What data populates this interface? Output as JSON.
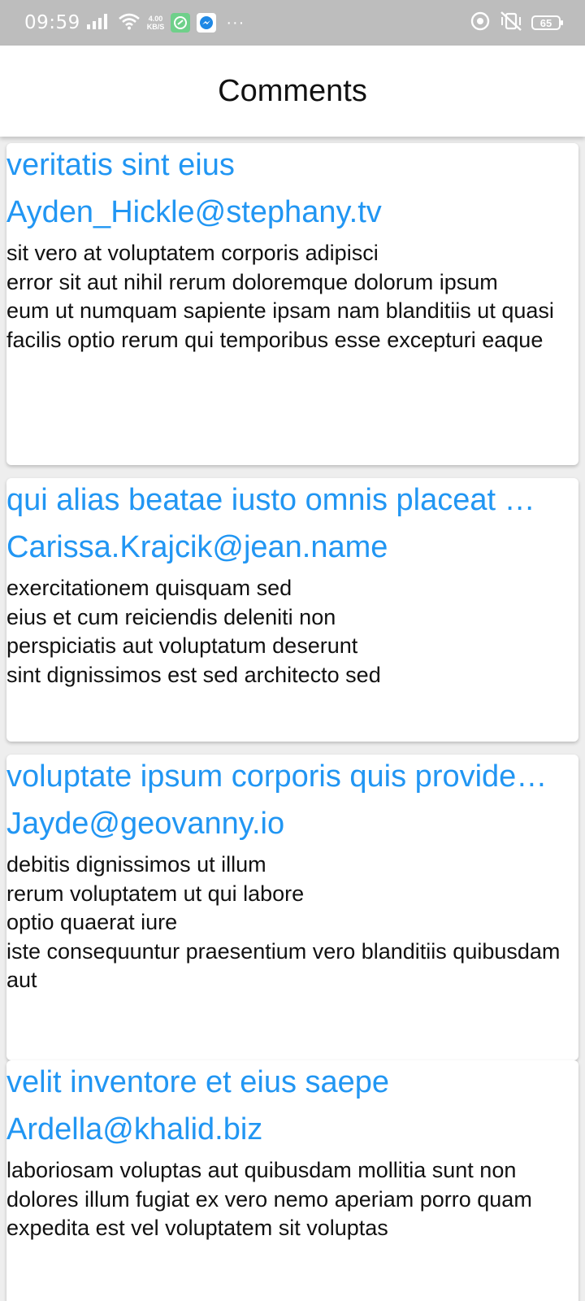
{
  "status_bar": {
    "time": "09:59",
    "speed_value": "4.00",
    "speed_unit": "KB/S",
    "more": "···",
    "battery": "65",
    "icons": [
      "signal-icon",
      "wifi-icon",
      "chat-app-icon",
      "messenger-icon",
      "sync-icon",
      "vibrate-off-icon",
      "battery-icon"
    ]
  },
  "header": {
    "title": "Comments"
  },
  "colors": {
    "accent": "#2196f3",
    "status_bar": "#bdbdbd",
    "background": "#eeeeee"
  },
  "comments": [
    {
      "name": "veritatis sint eius",
      "email": "Ayden_Hickle@stephany.tv",
      "body": "sit vero at voluptatem corporis adipisci\nerror sit aut nihil rerum doloremque dolorum ipsum\neum ut numquam sapiente ipsam nam blanditiis ut quasi\nfacilis optio rerum qui temporibus esse excepturi eaque"
    },
    {
      "name": "qui alias beatae iusto omnis placeat …",
      "email": "Carissa.Krajcik@jean.name",
      "body": "exercitationem quisquam sed\neius et cum reiciendis deleniti non\nperspiciatis aut voluptatum deserunt\nsint dignissimos est sed architecto sed"
    },
    {
      "name": "voluptate ipsum corporis quis provide…",
      "email": "Jayde@geovanny.io",
      "body": "debitis dignissimos ut illum\nrerum voluptatem ut qui labore\noptio quaerat iure\niste consequuntur praesentium vero blanditiis quibusdam aut"
    },
    {
      "name": "velit inventore et eius saepe",
      "email": "Ardella@khalid.biz",
      "body": "laboriosam voluptas aut quibusdam mollitia sunt non\ndolores illum fugiat ex vero nemo aperiam porro quam\nexpedita est vel voluptatem sit voluptas"
    }
  ]
}
